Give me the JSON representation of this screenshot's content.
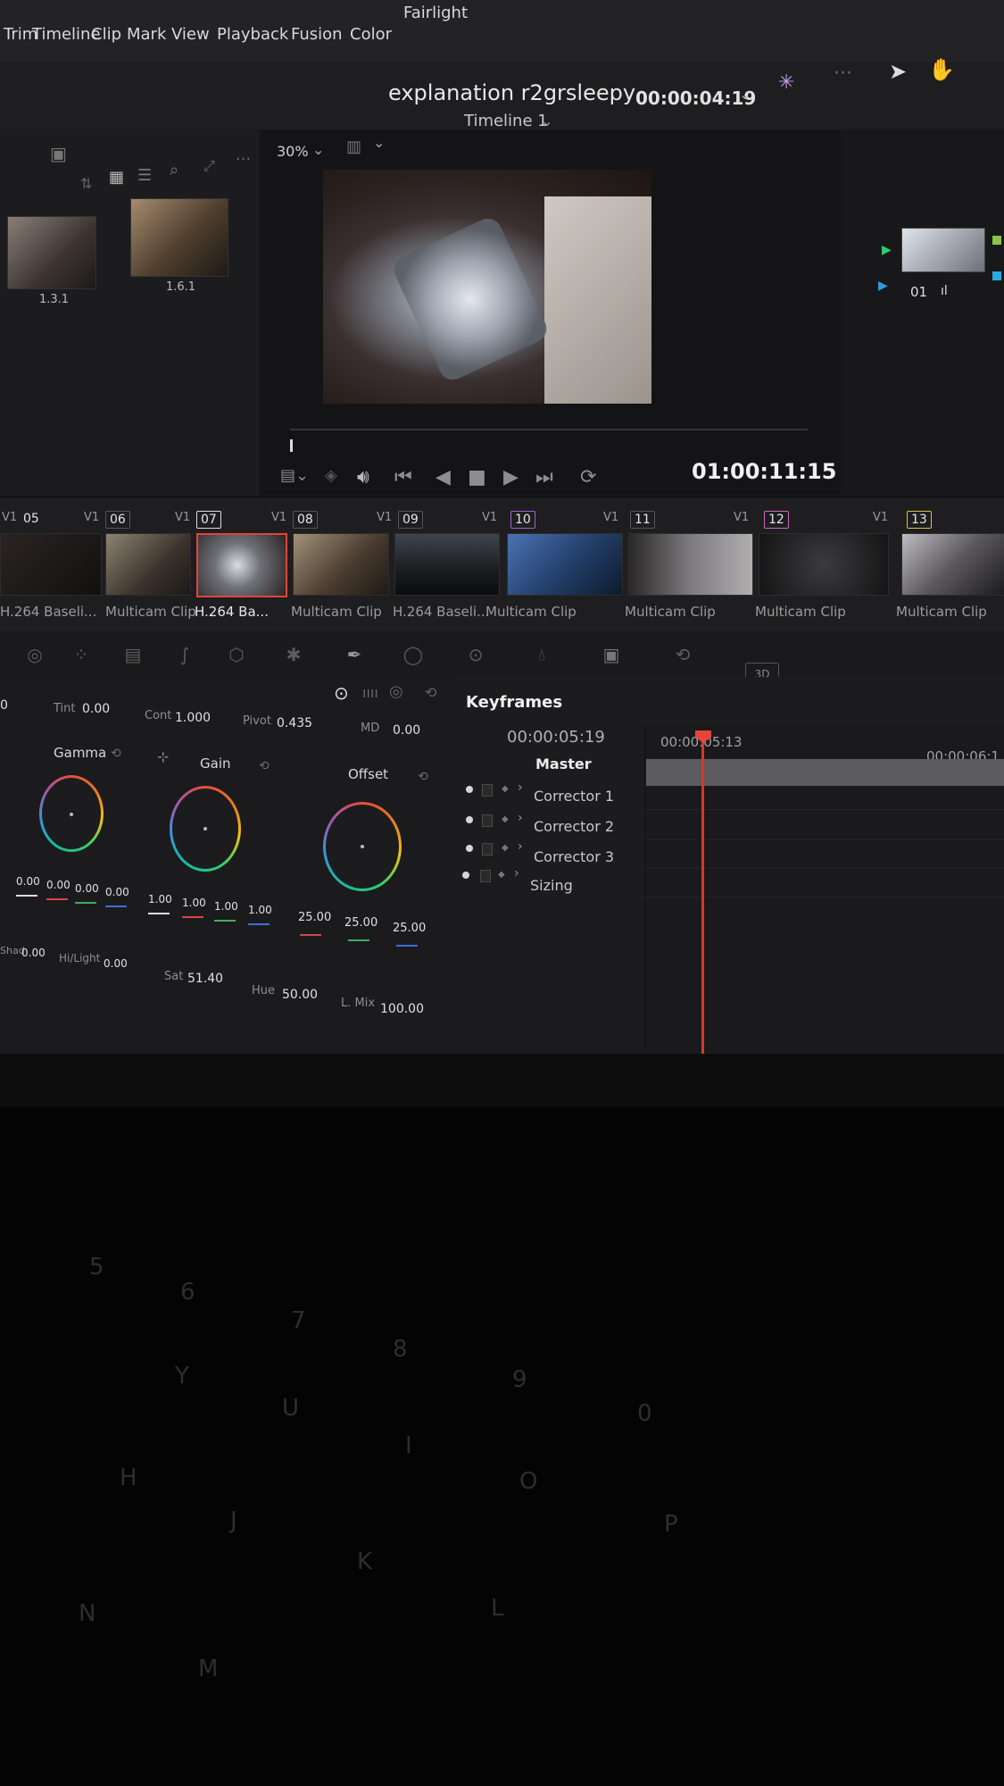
{
  "menu": {
    "items": [
      "Trim",
      "Timeline",
      "Clip",
      "Mark",
      "View",
      "Playback",
      "Fusion",
      "Color",
      "Fairlight"
    ]
  },
  "header": {
    "project_title": "explanation r2grsleepy",
    "timeline_name": "Timeline 1",
    "timecode": "00:00:04:19"
  },
  "media_pool": {
    "clips": [
      {
        "label": "1.3.1"
      },
      {
        "label": "1.6.1"
      }
    ]
  },
  "viewer": {
    "zoom": "30%",
    "timecode": "01:00:11:15",
    "progress": 0.0
  },
  "right_panel": {
    "clip_label": "01"
  },
  "clip_strip": {
    "track_label": "V1",
    "clips": [
      {
        "num": "05",
        "name": "H.264 Baseli..."
      },
      {
        "num": "06",
        "name": "Multicam Clip"
      },
      {
        "num": "07",
        "name": "H.264 Ba..."
      },
      {
        "num": "08",
        "name": "Multicam Clip"
      },
      {
        "num": "09",
        "name": "H.264 Baseli..."
      },
      {
        "num": "10",
        "name": "Multicam Clip"
      },
      {
        "num": "11",
        "name": "Multicam Clip"
      },
      {
        "num": "12",
        "name": "Multicam Clip"
      },
      {
        "num": "13",
        "name": "Multicam Clip"
      }
    ]
  },
  "toolbar": {
    "label_3d": "3D"
  },
  "color_wheels": {
    "tint_label": "Tint",
    "tint": "0.00",
    "cont_label": "Cont",
    "cont": "1.000",
    "pivot_label": "Pivot",
    "pivot": "0.435",
    "md_label": "MD",
    "md": "0.00",
    "first_value": "0",
    "gamma": {
      "title": "Gamma",
      "values": [
        "0.00",
        "0.00",
        "0.00",
        "0.00"
      ]
    },
    "gain": {
      "title": "Gain",
      "values": [
        "1.00",
        "1.00",
        "1.00",
        "1.00"
      ]
    },
    "offset": {
      "title": "Offset",
      "values": [
        "25.00",
        "25.00",
        "25.00"
      ]
    },
    "shad_label": "Shad",
    "shad": "0.00",
    "hilight_label": "Hi/Light",
    "hilight": "0.00",
    "sat_label": "Sat",
    "sat": "51.40",
    "hue_label": "Hue",
    "hue": "50.00",
    "lmix_label": "L. Mix",
    "lmix": "100.00"
  },
  "keyframes": {
    "title": "Keyframes",
    "timecode": "00:00:05:19",
    "master": "Master",
    "rows": [
      "Corrector 1",
      "Corrector 2",
      "Corrector 3",
      "Sizing"
    ],
    "ruler_start": "00:00:05:13",
    "ruler_end": "00:00:06:1"
  },
  "keyboard": {
    "keys": [
      "5",
      "6",
      "7",
      "8",
      "9",
      "0",
      "Y",
      "U",
      "I",
      "O",
      "P",
      "H",
      "J",
      "K",
      "L",
      "N",
      "M"
    ]
  }
}
